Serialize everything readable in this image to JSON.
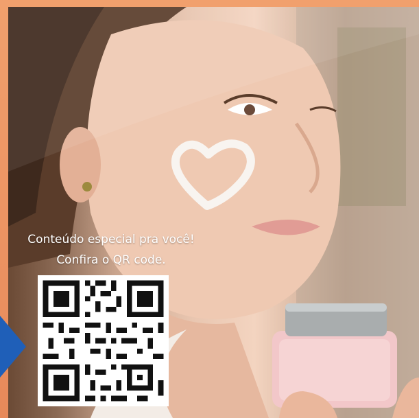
{
  "caption": {
    "line1": "Conteúdo especial pra você!",
    "line2": "Confira o QR code."
  },
  "qr": {
    "icon": "qr-code-icon"
  },
  "colors": {
    "frame": "#e7895a",
    "arrow": "#1f5fb8",
    "cream": "#f4ece6",
    "jar": "#f2c7c9"
  }
}
